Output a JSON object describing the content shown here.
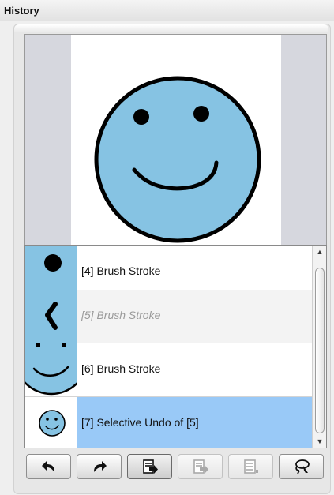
{
  "panel": {
    "title": "History"
  },
  "history": {
    "items": [
      {
        "label": "[4] Brush Stroke",
        "state": "normal"
      },
      {
        "label": "[5] Brush Stroke",
        "state": "undone"
      },
      {
        "label": "[6] Brush Stroke",
        "state": "normal"
      },
      {
        "label": "[7] Selective Undo of [5]",
        "state": "selected"
      }
    ]
  },
  "toolbar": {
    "buttons": [
      {
        "icon": "undo-arrow-icon",
        "enabled": true
      },
      {
        "icon": "redo-arrow-icon",
        "enabled": true
      },
      {
        "icon": "selective-undo-icon",
        "enabled": true
      },
      {
        "icon": "selective-redo-icon",
        "enabled": false
      },
      {
        "icon": "compound-actions-icon",
        "enabled": false
      },
      {
        "icon": "lasso-select-icon",
        "enabled": true
      }
    ]
  },
  "colors": {
    "face_fill": "#86c3e3",
    "selected_row": "#99c9f7",
    "preview_background": "#d6d7de"
  }
}
